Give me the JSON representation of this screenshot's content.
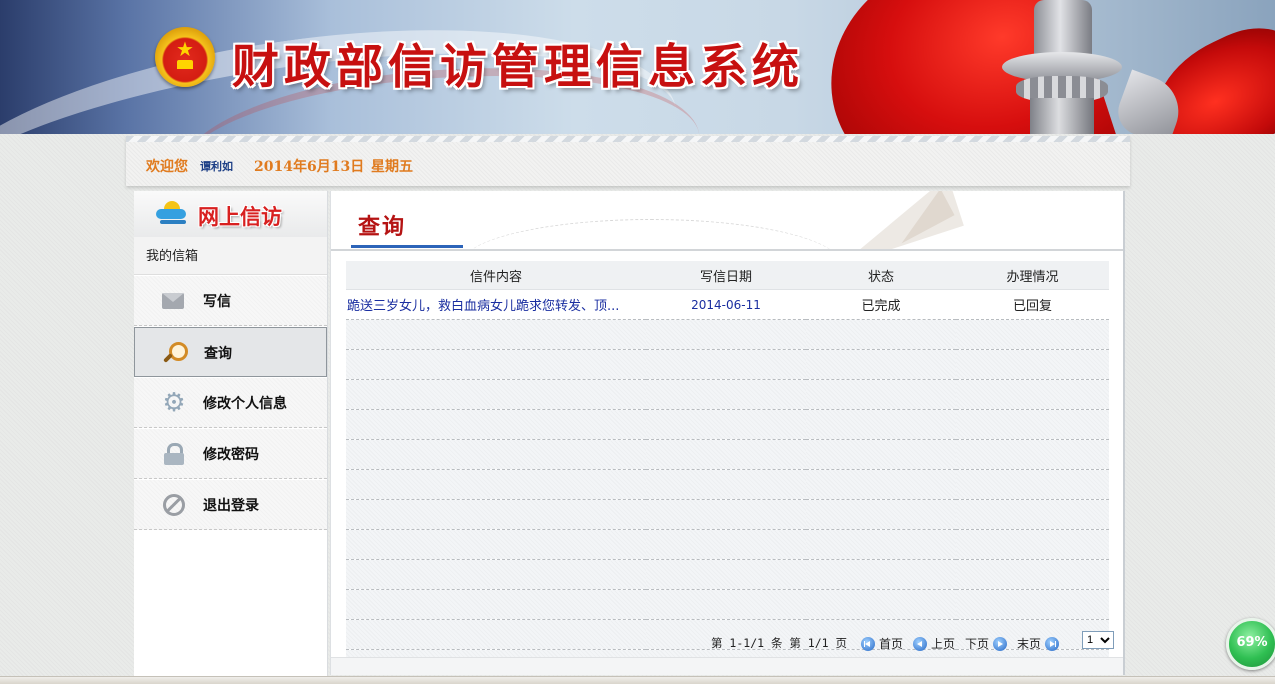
{
  "banner": {
    "title": "财政部信访管理信息系统"
  },
  "welcome": {
    "greeting": "欢迎您",
    "user": "谭利如",
    "date": "2014年6月13日",
    "weekday": "星期五"
  },
  "sidebar": {
    "title": "网上信访",
    "section": "我的信箱",
    "items": [
      {
        "label": "写信",
        "icon": "envelope-icon"
      },
      {
        "label": "查询",
        "icon": "magnifier-icon"
      },
      {
        "label": "修改个人信息",
        "icon": "gear-icon"
      },
      {
        "label": "修改密码",
        "icon": "lock-icon"
      },
      {
        "label": "退出登录",
        "icon": "ban-icon"
      }
    ]
  },
  "main": {
    "title": "查询",
    "table": {
      "headers": [
        "信件内容",
        "写信日期",
        "状态",
        "办理情况"
      ],
      "rows": [
        {
          "subject": "跪送三岁女儿，救白血病女儿跪求您转发、顶...",
          "date": "2014-06-11",
          "status": "已完成",
          "progress": "已回复"
        }
      ]
    },
    "pager": {
      "summary": "第 1-1/1 条 第 1/1 页",
      "first": "首页",
      "prev": "上页",
      "next": "下页",
      "last": "末页",
      "page_value": "1"
    }
  },
  "badge": {
    "value": "69%"
  },
  "colors": {
    "title_red": "#c71010",
    "accent_blue": "#2c64b9",
    "welcome_orange": "#e07b1f"
  }
}
